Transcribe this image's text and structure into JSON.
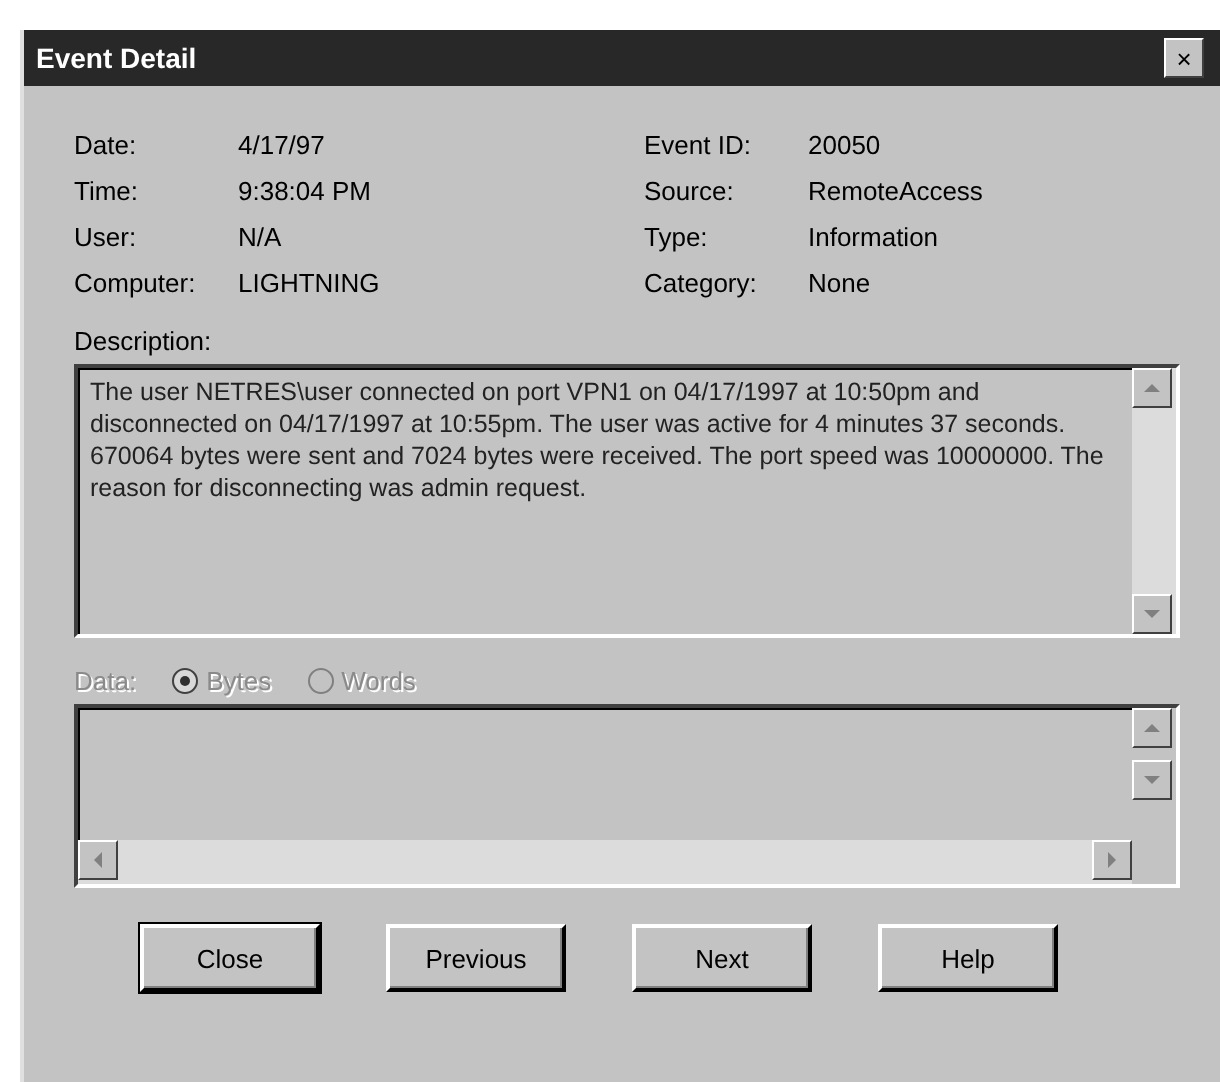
{
  "window": {
    "title": "Event Detail",
    "close_glyph": "×"
  },
  "left_fields": [
    {
      "label": "Date:",
      "value": "4/17/97"
    },
    {
      "label": "Time:",
      "value": "9:38:04 PM"
    },
    {
      "label": "User:",
      "value": "N/A"
    },
    {
      "label": "Computer:",
      "value": "LIGHTNING"
    }
  ],
  "right_fields": [
    {
      "label": "Event ID:",
      "value": "20050"
    },
    {
      "label": "Source:",
      "value": "RemoteAccess"
    },
    {
      "label": "Type:",
      "value": "Information"
    },
    {
      "label": "Category:",
      "value": "None"
    }
  ],
  "description": {
    "label": "Description:",
    "text": "The user NETRES\\user connected on port VPN1 on 04/17/1997 at 10:50pm and disconnected on 04/17/1997 at 10:55pm.  The user was active for 4 minutes 37 seconds.  670064 bytes were sent and 7024 bytes were received.  The port speed was 10000000.  The reason for disconnecting was admin request."
  },
  "data": {
    "label": "Data:",
    "disabled": true,
    "options": [
      {
        "label": "Bytes",
        "selected": true
      },
      {
        "label": "Words",
        "selected": false
      }
    ]
  },
  "buttons": [
    {
      "label": "Close",
      "default": true
    },
    {
      "label": "Previous",
      "default": false
    },
    {
      "label": "Next",
      "default": false
    },
    {
      "label": "Help",
      "default": false
    }
  ]
}
